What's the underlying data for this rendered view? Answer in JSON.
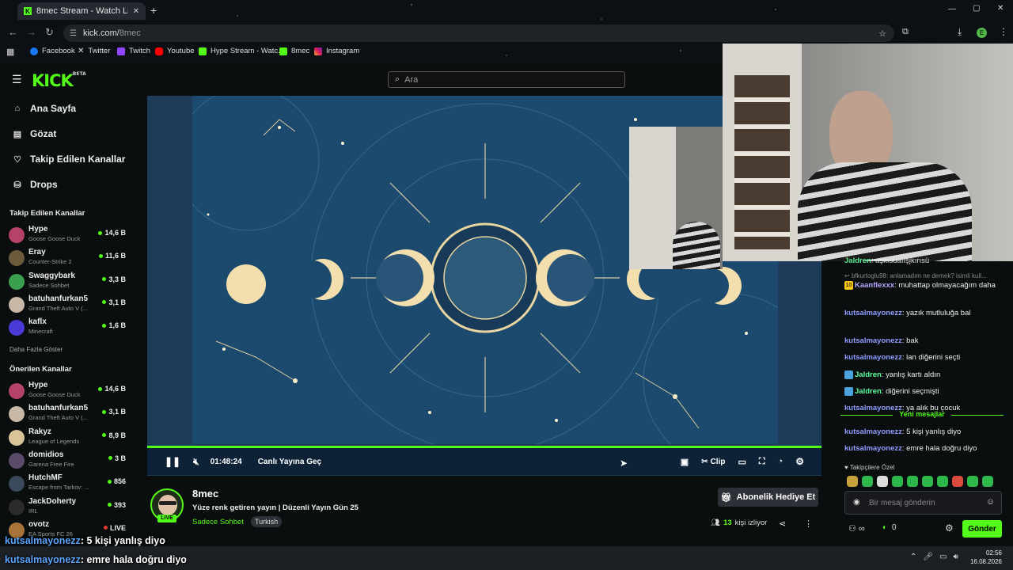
{
  "browser": {
    "tab_title": "8mec Stream - Watch Live on Kick",
    "url_host": "kick.com/",
    "url_path": "8mec",
    "profile_initial": "E",
    "bookmarks": [
      "Facebook",
      "Twitter",
      "Twitch",
      "Youtube",
      "Hype Stream - Watc...",
      "8mec",
      "Instagram"
    ]
  },
  "header": {
    "logo": "KICK",
    "logo_badge": "BETA",
    "search_placeholder": "Ara"
  },
  "nav": [
    "Ana Sayfa",
    "Gözat",
    "Takip Edilen Kanallar",
    "Drops"
  ],
  "followed": {
    "title": "Takip Edilen Kanallar",
    "channels": [
      {
        "name": "Hype",
        "game": "Goose Goose Duck",
        "viewers": "14,6 B",
        "color": "#b5426b"
      },
      {
        "name": "Eray",
        "game": "Counter-Strike 2",
        "viewers": "11,6 B",
        "color": "#6b5b3a"
      },
      {
        "name": "Swaggybark",
        "game": "Sadece Sohbet",
        "viewers": "3,3 B",
        "color": "#3aa050"
      },
      {
        "name": "batuhanfurkan5",
        "game": "Grand Theft Auto V (...",
        "viewers": "3,1 B",
        "color": "#c9b8a8"
      },
      {
        "name": "kaflx",
        "game": "Minecraft",
        "viewers": "1,6 B",
        "color": "#4a3ad6"
      }
    ],
    "more": "Daha Fazla Göster"
  },
  "recommended": {
    "title": "Önerilen Kanallar",
    "channels": [
      {
        "name": "Hype",
        "game": "Goose Goose Duck",
        "viewers": "14,6 B",
        "color": "#b5426b"
      },
      {
        "name": "batuhanfurkan5",
        "game": "Grand Theft Auto V (...",
        "viewers": "3,1 B",
        "color": "#c9b8a8"
      },
      {
        "name": "Rakyz",
        "game": "League of Legends",
        "viewers": "8,9 B",
        "color": "#d9c49a"
      },
      {
        "name": "domidios",
        "game": "Garena Free Fire",
        "viewers": "3 B",
        "color": "#5a4b6b"
      },
      {
        "name": "HutchMF",
        "game": "Escape from Tarkov: ...",
        "viewers": "856",
        "color": "#3a4a5a"
      },
      {
        "name": "JackDoherty",
        "game": "IRL",
        "viewers": "393",
        "color": "#2b2b2b"
      },
      {
        "name": "ovotz",
        "game": "EA Sports FC 26",
        "viewers": "LIVE",
        "color": "#a8743a"
      }
    ]
  },
  "player": {
    "time": "01:48:24",
    "go_live": "Canlı Yayına Geç",
    "clip": "Clip"
  },
  "stream": {
    "name": "8mec",
    "title": "Yüze renk getiren yayın | Düzenli Yayın Gün 25",
    "category": "Sadece Sohbet",
    "tag": "Turkish",
    "live": "LIVE",
    "gift": "Abonelik Hediye Et",
    "viewer_count": "13",
    "viewer_label": "kişi izliyor"
  },
  "chat": {
    "partial_top": {
      "user": "Jaldren",
      "text": ": aşkısuaıışjkırısü"
    },
    "reply_hint": "bfkurtoglu98: anlamadım ne demek? isimli kull...",
    "messages": [
      {
        "badge": "10",
        "user": "Kaanflexxx",
        "text": ": muhattap olmayacağım daha",
        "color": "#b9a6ff"
      },
      {
        "user": "kutsalmayonezz",
        "text": ": yazık mutluluğa bal",
        "color": "#8f9cff"
      },
      {
        "user": "kutsalmayonezz",
        "text": ": bak",
        "color": "#8f9cff"
      },
      {
        "user": "kutsalmayonezz",
        "text": ": lan diğerini seçti",
        "color": "#8f9cff"
      },
      {
        "badge": "J",
        "user": "Jaldren",
        "text": ": yanlış kartı aldın",
        "color": "#5effa0"
      },
      {
        "badge": "J",
        "user": "Jaldren",
        "text": ": diğerini seçmişti",
        "color": "#5effa0"
      },
      {
        "user": "kutsalmayonezz",
        "text": ": ya alık bu çocuk",
        "color": "#8f9cff"
      }
    ],
    "new_messages": "Yeni mesajlar",
    "after": [
      {
        "user": "kutsalmayonezz",
        "text": ": 5 kişi yanlış diyo",
        "color": "#8f9cff"
      },
      {
        "user": "kutsalmayonezz",
        "text": ": emre hala doğru diyo",
        "color": "#8f9cff"
      }
    ],
    "followers_only": "Takipçilere Özel",
    "input_placeholder": "Bir mesaj gönderin",
    "points": "0",
    "send": "Gönder"
  },
  "overlay": [
    {
      "user": "kutsalmayonezz",
      "text": ": 5 kişi yanlış diyo"
    },
    {
      "user": "kutsalmayonezz",
      "text": ": emre hala doğru diyo"
    }
  ],
  "taskbar": {
    "time": "02:56",
    "date": "16.08.2026"
  },
  "colors": {
    "accent": "#53fc18",
    "bg": "#0b0e0f"
  }
}
